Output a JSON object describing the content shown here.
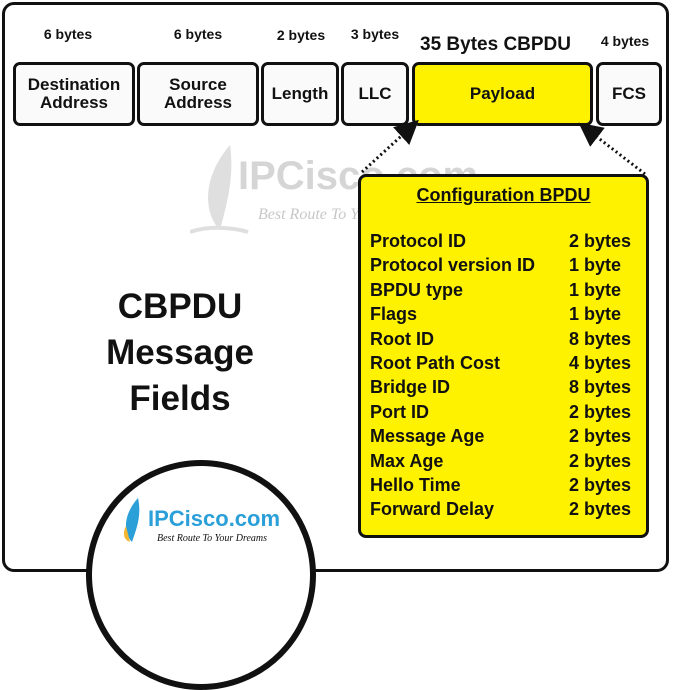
{
  "frame": {
    "fields": [
      {
        "label": "Destination Address",
        "size": "6 bytes"
      },
      {
        "label": "Source Address",
        "size": "6 bytes"
      },
      {
        "label": "Length",
        "size": "2 bytes"
      },
      {
        "label": "LLC",
        "size": "3 bytes"
      },
      {
        "label": "Payload",
        "size": "35 Bytes CBPDU"
      },
      {
        "label": "FCS",
        "size": "4 bytes"
      }
    ]
  },
  "watermark": {
    "brand": "IPCisco.com",
    "tagline": "Best Route To Your Dreams"
  },
  "config_bpdu": {
    "title": "Configuration BPDU",
    "rows": [
      {
        "name": "Protocol ID",
        "size": "2 bytes"
      },
      {
        "name": "Protocol version ID",
        "size": "1 byte"
      },
      {
        "name": "BPDU type",
        "size": "1 byte"
      },
      {
        "name": "Flags",
        "size": "1 byte"
      },
      {
        "name": "Root ID",
        "size": "8 bytes"
      },
      {
        "name": "Root Path Cost",
        "size": "4 bytes"
      },
      {
        "name": "Bridge ID",
        "size": "8 bytes"
      },
      {
        "name": "Port ID",
        "size": "2 bytes"
      },
      {
        "name": "Message Age",
        "size": "2 bytes"
      },
      {
        "name": "Max Age",
        "size": "2 bytes"
      },
      {
        "name": "Hello Time",
        "size": "2 bytes"
      },
      {
        "name": "Forward Delay",
        "size": "2 bytes"
      }
    ]
  },
  "title": {
    "line1": "CBPDU",
    "line2": "Message",
    "line3": "Fields"
  },
  "logo": {
    "brand": "IPCisco.com",
    "tagline": "Best Route To Your Dreams",
    "accent": "#2a9fd8"
  },
  "colors": {
    "payload": "#fff200",
    "border": "#111111"
  }
}
